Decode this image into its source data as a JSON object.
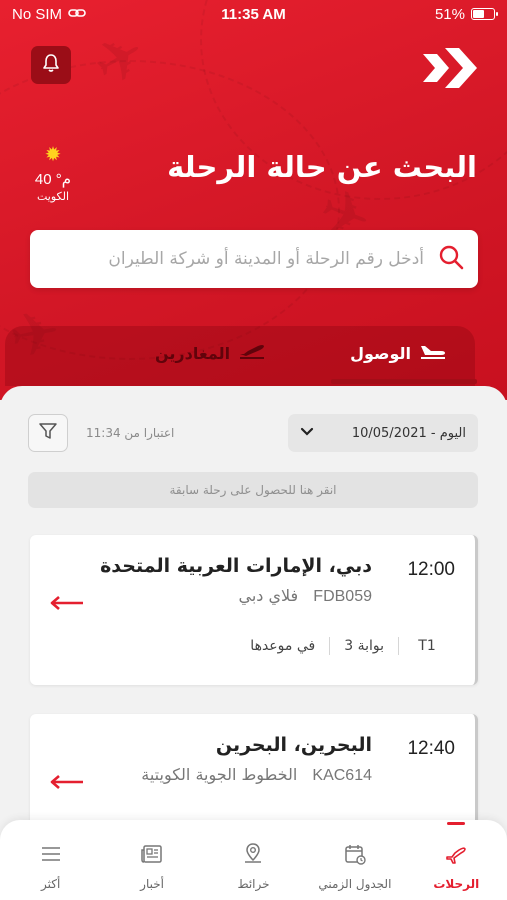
{
  "status": {
    "carrier": "No SIM",
    "time": "11:35 AM",
    "battery": "51%"
  },
  "weather": {
    "temp": "40 °م",
    "city": "الكويت"
  },
  "header": {
    "title": "البحث عن حالة الرحلة"
  },
  "search": {
    "placeholder": "أدخل رقم الرحلة أو المدينة أو شركة الطيران"
  },
  "tabs": {
    "arrival": "الوصول",
    "departure": "المغادرين"
  },
  "filters": {
    "date": "اليوم - 10/05/2021",
    "as_of": "اعتبارا من 11:34"
  },
  "previous": {
    "label": "انقر هنا للحصول على رحلة سابقة"
  },
  "flights": [
    {
      "time": "12:00",
      "destination": "دبي، الإمارات العربية المتحدة",
      "flight_no": "FDB059",
      "airline": "فلاي دبي",
      "terminal": "T1",
      "gate": "بوابة 3",
      "status": "في موعدها"
    },
    {
      "time": "12:40",
      "destination": "البحرين، البحرين",
      "flight_no": "KAC614",
      "airline": "الخطوط الجوية الكويتية"
    }
  ],
  "nav": [
    {
      "label": "الرحلات",
      "icon": "plane-icon",
      "active": true
    },
    {
      "label": "الجدول الزمني",
      "icon": "calendar-icon",
      "active": false
    },
    {
      "label": "خرائط",
      "icon": "map-pin-icon",
      "active": false
    },
    {
      "label": "أخبار",
      "icon": "news-icon",
      "active": false
    },
    {
      "label": "أكثر",
      "icon": "menu-icon",
      "active": false
    }
  ],
  "colors": {
    "brand": "#e41f2f",
    "dark_red": "#9b0d17"
  }
}
